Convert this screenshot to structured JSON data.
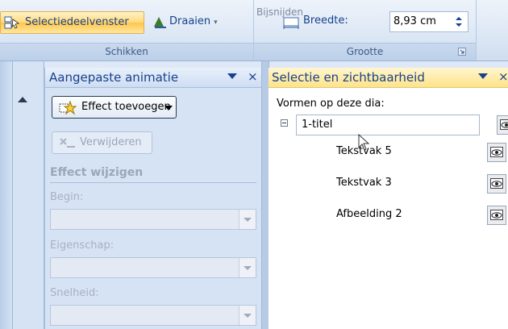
{
  "ribbon": {
    "arrange": {
      "selection_pane_label": "Selectiedeelvenster",
      "rotate_label": "Draaien",
      "rotate_arrow": "▾",
      "group_label": "Schikken"
    },
    "size": {
      "crop_label": "Bijsnijden",
      "width_label": "Breedte:",
      "width_value": "8,93 cm",
      "group_label": "Grootte"
    }
  },
  "animation_pane": {
    "title": "Aangepaste animatie",
    "add_effect_label": "Effect toevoegen",
    "remove_label": "Verwijderen",
    "modify_effect_heading": "Effect wijzigen",
    "start_label": "Begin:",
    "property_label": "Eigenschap:",
    "speed_label": "Snelheid:"
  },
  "selection_pane": {
    "title": "Selectie en zichtbaarheid",
    "shapes_label": "Vormen op deze dia:",
    "title_item": "1-titel",
    "items": [
      "Tekstvak 5",
      "Tekstvak 3",
      "Afbeelding 2"
    ]
  },
  "close_glyph": "×",
  "colors": {
    "accent": "#15428b",
    "highlight": "#ffd97a"
  }
}
